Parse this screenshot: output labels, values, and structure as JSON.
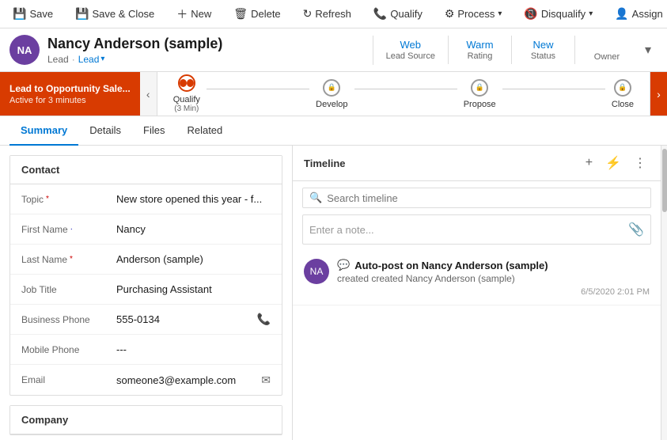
{
  "toolbar": {
    "save_label": "Save",
    "save_close_label": "Save & Close",
    "new_label": "New",
    "delete_label": "Delete",
    "refresh_label": "Refresh",
    "qualify_label": "Qualify",
    "process_label": "Process",
    "disqualify_label": "Disqualify",
    "assign_label": "Assign",
    "more_icon": "⋯"
  },
  "header": {
    "avatar_initials": "NA",
    "name": "Nancy Anderson (sample)",
    "role": "Lead",
    "lead_label": "Lead",
    "meta": [
      {
        "value": "Web",
        "label": "Lead Source"
      },
      {
        "value": "Warm",
        "label": "Rating"
      },
      {
        "value": "New",
        "label": "Status"
      },
      {
        "value": "",
        "label": "Owner"
      }
    ]
  },
  "stage_bar": {
    "promo_title": "Lead to Opportunity Sale...",
    "promo_sub": "Active for 3 minutes",
    "stages": [
      {
        "label": "Qualify",
        "sublabel": "(3 Min)",
        "state": "active"
      },
      {
        "label": "Develop",
        "state": "locked"
      },
      {
        "label": "Propose",
        "state": "locked"
      },
      {
        "label": "Close",
        "state": "locked"
      }
    ],
    "nav_left": "‹",
    "nav_right": "›"
  },
  "tabs": [
    {
      "label": "Summary",
      "active": true
    },
    {
      "label": "Details",
      "active": false
    },
    {
      "label": "Files",
      "active": false
    },
    {
      "label": "Related",
      "active": false
    }
  ],
  "contact": {
    "section_title": "Contact",
    "fields": [
      {
        "label": "Topic",
        "required": true,
        "value": "New store opened this year - f...",
        "icon": ""
      },
      {
        "label": "First Name",
        "required": true,
        "value": "Nancy",
        "icon": ""
      },
      {
        "label": "Last Name",
        "required": true,
        "value": "Anderson (sample)",
        "icon": ""
      },
      {
        "label": "Job Title",
        "required": false,
        "value": "Purchasing Assistant",
        "icon": ""
      },
      {
        "label": "Business Phone",
        "required": false,
        "value": "555-0134",
        "icon": "📞"
      },
      {
        "label": "Mobile Phone",
        "required": false,
        "value": "---",
        "icon": ""
      },
      {
        "label": "Email",
        "required": false,
        "value": "someone3@example.com",
        "icon": "✉"
      }
    ]
  },
  "company": {
    "section_title": "Company"
  },
  "timeline": {
    "title": "Timeline",
    "search_placeholder": "Search timeline",
    "note_placeholder": "Enter a note...",
    "add_icon": "+",
    "filter_icon": "⚡",
    "more_icon": "⋮",
    "items": [
      {
        "avatar_initials": "NA",
        "icon": "💬",
        "title": "Auto-post on Nancy Anderson (sample)",
        "sub": "created Nancy Anderson (sample)",
        "time": "6/5/2020 2:01 PM"
      }
    ]
  }
}
